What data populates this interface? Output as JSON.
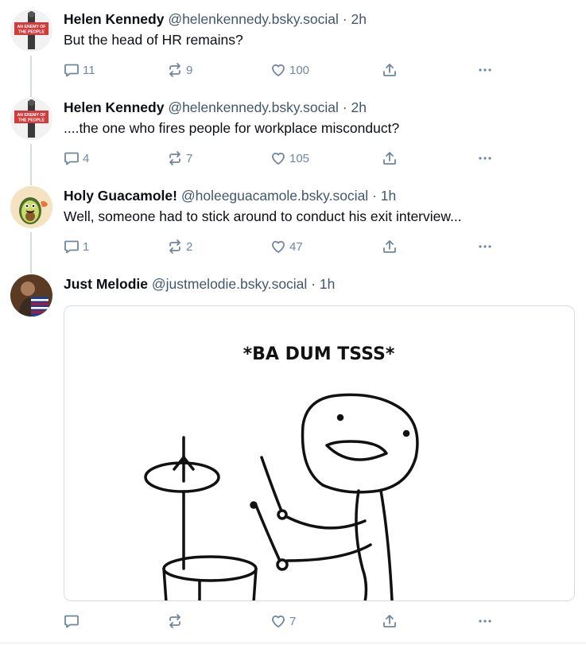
{
  "posts": [
    {
      "author": "Helen Kennedy",
      "handle": "@helenkennedy.bsky.social",
      "separator": "·",
      "time": "2h",
      "text": "But the head of HR remains?",
      "avatar": "an-enemy-of-the-people-avatar",
      "avatar_text": "AN ENEMY OF THE PEOPLE",
      "replies": "11",
      "reposts": "9",
      "likes": "100"
    },
    {
      "author": "Helen Kennedy",
      "handle": "@helenkennedy.bsky.social",
      "separator": "·",
      "time": "2h",
      "text": "....the one who fires people for workplace misconduct?",
      "avatar": "an-enemy-of-the-people-avatar",
      "avatar_text": "AN ENEMY OF THE PEOPLE",
      "replies": "4",
      "reposts": "7",
      "likes": "105"
    },
    {
      "author": "Holy Guacamole!",
      "handle": "@holeeguacamole.bsky.social",
      "separator": "·",
      "time": "1h",
      "text": "Well, someone had to stick around to conduct his exit interview...",
      "avatar": "avocado-avatar",
      "replies": "1",
      "reposts": "2",
      "likes": "47"
    },
    {
      "author": "Just Melodie",
      "handle": "@justmelodie.bsky.social",
      "separator": "·",
      "time": "1h",
      "text": "",
      "avatar": "flag-portrait-avatar",
      "image_caption": "*BA DUM TSSS*",
      "replies": "",
      "reposts": "",
      "likes": "7"
    }
  ],
  "icons": {
    "reply": "reply-icon",
    "repost": "repost-icon",
    "like": "heart-icon",
    "share": "share-icon",
    "more": "more-icon"
  },
  "colors": {
    "text": "#0b0f14",
    "secondary": "#42576c",
    "icon": "#6f869f",
    "thread_line": "#d4dbe2",
    "badge_red": "#d23b3b"
  }
}
